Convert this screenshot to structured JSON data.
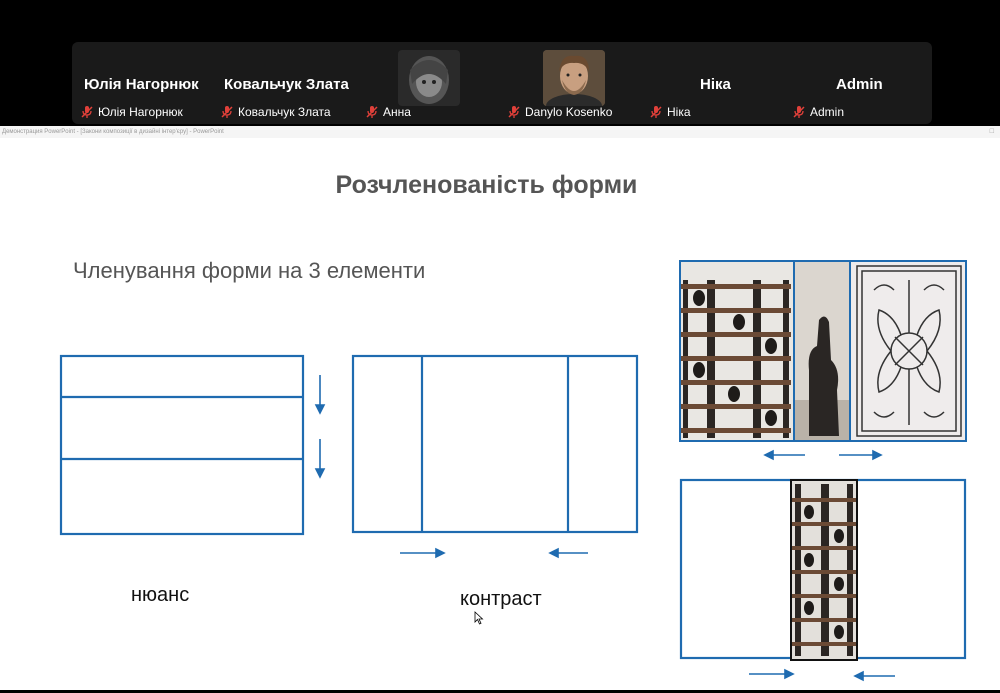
{
  "window": {
    "title": "Демонстрация PowerPoint - [Закони композиції в дизайні інтер'єру] - PowerPoint"
  },
  "participants": [
    {
      "display_name": "Юлія Нагорнюк",
      "tag_name": "Юлія Нагорнюк",
      "muted": true,
      "has_photo": false
    },
    {
      "display_name": "Ковальчук Злата",
      "tag_name": "Ковальчук Злата",
      "muted": true,
      "has_photo": false
    },
    {
      "display_name": "",
      "tag_name": "Анна",
      "muted": true,
      "has_photo": true
    },
    {
      "display_name": "",
      "tag_name": "Danylo Kosenko",
      "muted": true,
      "has_photo": true
    },
    {
      "display_name": "Ніка",
      "tag_name": "Ніка",
      "muted": true,
      "has_photo": false
    },
    {
      "display_name": "Admin",
      "tag_name": "Admin",
      "muted": true,
      "has_photo": false
    }
  ],
  "slide": {
    "title": "Розчленованість форми",
    "subtitle": "Членування форми на 3 елементи",
    "label_nuance": "нюанс",
    "label_contrast": "контраст"
  },
  "colors": {
    "accent_blue": "#1f6bb0",
    "strip_bg": "#1a1a1a",
    "mic_red": "#e0403a"
  }
}
